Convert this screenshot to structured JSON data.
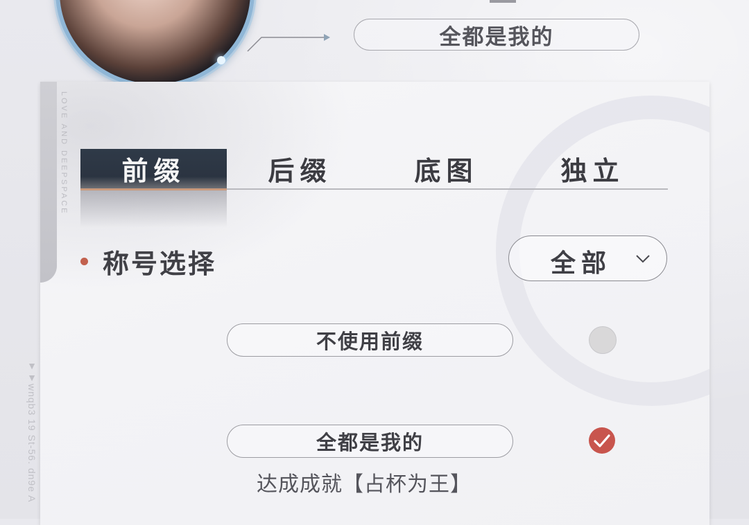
{
  "header": {
    "current_title": "全都是我的"
  },
  "panel": {
    "side_text": "LOVE AND DEEPSPACE",
    "tabs": [
      {
        "label": "前缀",
        "active": true
      },
      {
        "label": "后缀",
        "active": false
      },
      {
        "label": "底图",
        "active": false
      },
      {
        "label": "独立",
        "active": false
      }
    ],
    "section_title": "称号选择",
    "filter": {
      "selected": "全部"
    },
    "options": [
      {
        "label": "不使用前缀",
        "selected": false
      },
      {
        "label": "全都是我的",
        "selected": true,
        "source": "达成成就【占杯为王】"
      }
    ]
  },
  "edge_text": "▼▼wnqb3  19 St-56. dn9e A",
  "colors": {
    "accent_red": "#c8554d",
    "tab_active_bg": "#2f3a48",
    "section_dot": "#c2614e"
  },
  "icons": {
    "dropdown": "chevron-down-icon",
    "selected": "checkmark-icon"
  }
}
